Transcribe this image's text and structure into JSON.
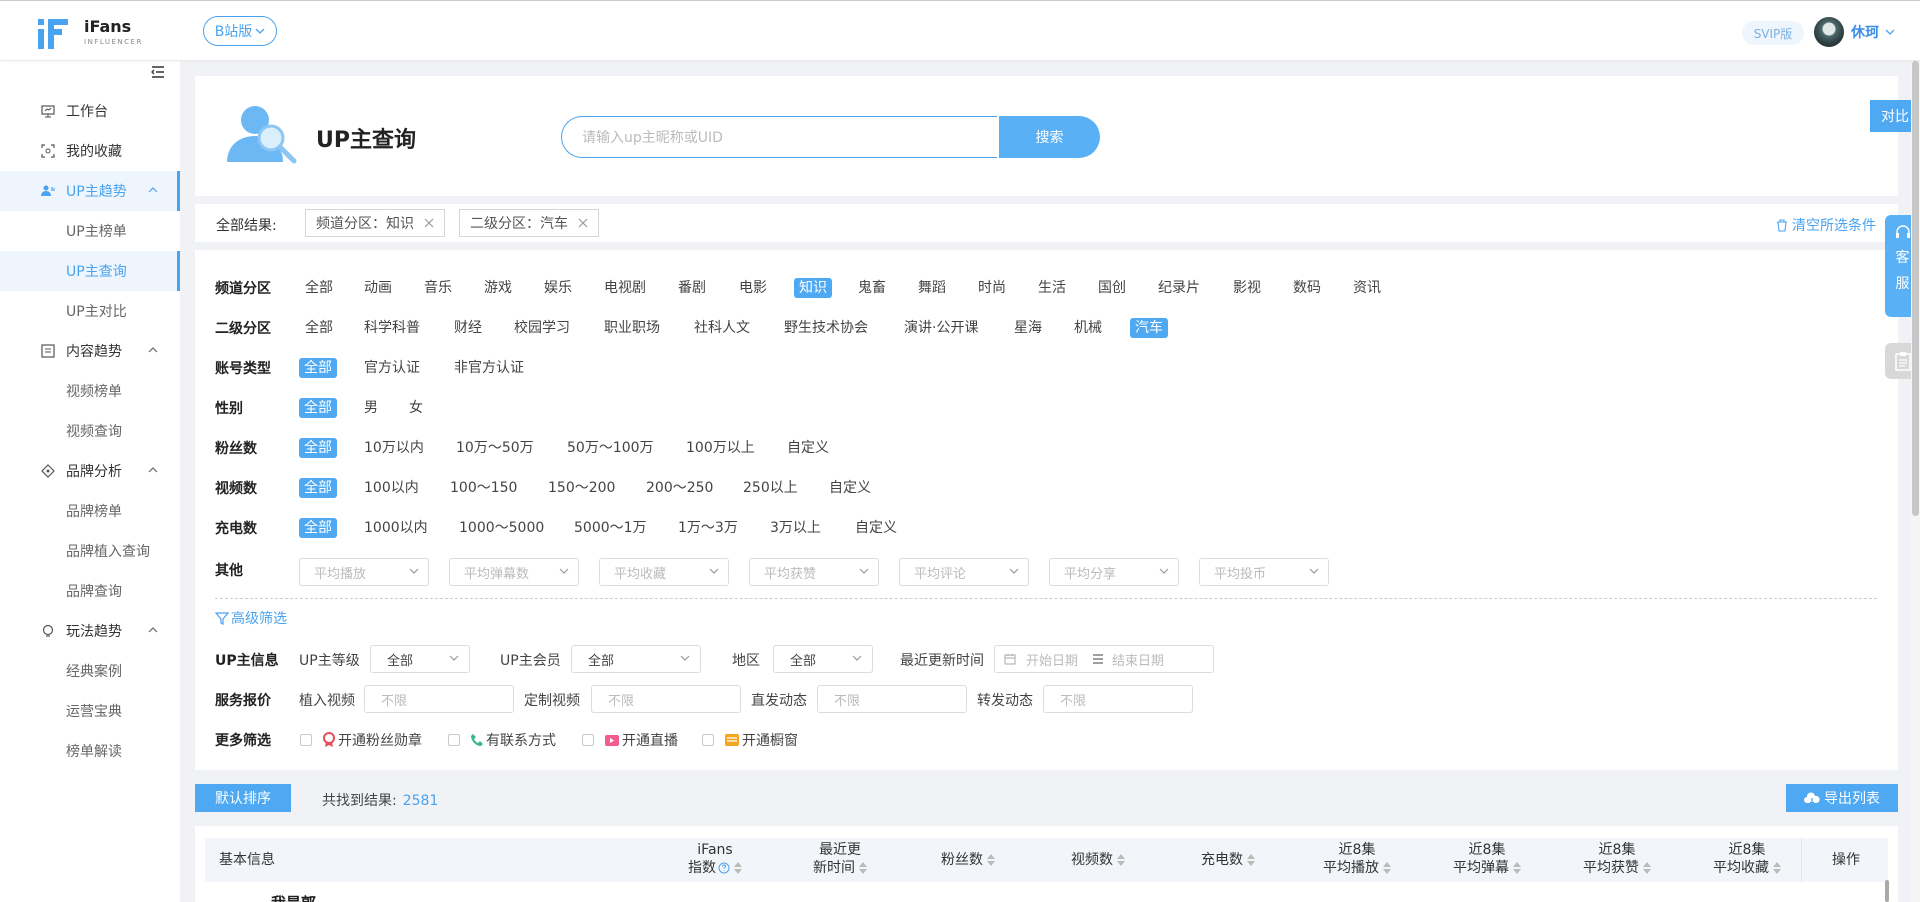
{
  "header": {
    "logo_text": "iFans",
    "logo_sub": "INFLUENCER",
    "version_label": "B站版",
    "svip_label": "SVIP版",
    "username": "休珂"
  },
  "sidebar": {
    "items": [
      {
        "label": "工作台",
        "icon": "monitor-icon"
      },
      {
        "label": "我的收藏",
        "icon": "collection-icon"
      },
      {
        "label": "UP主趋势",
        "icon": "users-icon"
      },
      {
        "label": "UP主榜单"
      },
      {
        "label": "UP主查询"
      },
      {
        "label": "UP主对比"
      },
      {
        "label": "内容趋势",
        "icon": "content-icon"
      },
      {
        "label": "视频榜单"
      },
      {
        "label": "视频查询"
      },
      {
        "label": "品牌分析",
        "icon": "diamond-icon"
      },
      {
        "label": "品牌榜单"
      },
      {
        "label": "品牌植入查询"
      },
      {
        "label": "品牌查询"
      },
      {
        "label": "玩法趋势",
        "icon": "bulb-icon"
      },
      {
        "label": "经典案例"
      },
      {
        "label": "运营宝典"
      },
      {
        "label": "榜单解读"
      }
    ]
  },
  "search": {
    "title": "UP主查询",
    "placeholder": "请输入up主昵称或UID",
    "button": "搜索"
  },
  "results": {
    "label": "全部结果:",
    "chips": [
      "频道分区：知识",
      "二级分区：汽车"
    ],
    "clear": "清空所选条件"
  },
  "filters": {
    "channel": {
      "label": "频道分区",
      "options": [
        "全部",
        "动画",
        "音乐",
        "游戏",
        "娱乐",
        "电视剧",
        "番剧",
        "电影",
        "知识",
        "鬼畜",
        "舞蹈",
        "时尚",
        "生活",
        "国创",
        "纪录片",
        "影视",
        "数码",
        "资讯"
      ]
    },
    "sub": {
      "label": "二级分区",
      "options": [
        "全部",
        "科学科普",
        "财经",
        "校园学习",
        "职业职场",
        "社科人文",
        "野生技术协会",
        "演讲·公开课",
        "星海",
        "机械",
        "汽车"
      ]
    },
    "account": {
      "label": "账号类型",
      "options": [
        "全部",
        "官方认证",
        "非官方认证"
      ]
    },
    "gender": {
      "label": "性别",
      "options": [
        "全部",
        "男",
        "女"
      ]
    },
    "fans": {
      "label": "粉丝数",
      "options": [
        "全部",
        "10万以内",
        "10万～50万",
        "50万～100万",
        "100万以上",
        "自定义"
      ]
    },
    "videos": {
      "label": "视频数",
      "options": [
        "全部",
        "100以内",
        "100～150",
        "150～200",
        "200～250",
        "250以上",
        "自定义"
      ]
    },
    "charge": {
      "label": "充电数",
      "options": [
        "全部",
        "1000以内",
        "1000～5000",
        "5000～1万",
        "1万～3万",
        "3万以上",
        "自定义"
      ]
    },
    "other": {
      "label": "其他",
      "dropdowns": [
        "平均播放",
        "平均弹幕数",
        "平均收藏",
        "平均获赞",
        "平均评论",
        "平均分享",
        "平均投币"
      ]
    },
    "advanced": "高级筛选",
    "upinfo": {
      "label": "UP主信息",
      "level_label": "UP主等级",
      "level_value": "全部",
      "member_label": "UP主会员",
      "member_value": "全部",
      "region_label": "地区",
      "region_value": "全部",
      "update_label": "最近更新时间",
      "start_ph": "开始日期",
      "end_ph": "结束日期"
    },
    "price": {
      "label": "服务报价",
      "fields": [
        {
          "label": "植入视频",
          "ph": "不限"
        },
        {
          "label": "定制视频",
          "ph": "不限"
        },
        {
          "label": "直发动态",
          "ph": "不限"
        },
        {
          "label": "转发动态",
          "ph": "不限"
        }
      ]
    },
    "more": {
      "label": "更多筛选",
      "items": [
        "开通粉丝勋章",
        "有联系方式",
        "开通直播",
        "开通橱窗"
      ]
    }
  },
  "toolbar": {
    "sort": "默认排序",
    "found_label": "共找到结果:",
    "found_count": "2581",
    "export": "导出列表"
  },
  "table": {
    "headers": [
      {
        "l1": "基本信息",
        "l2": ""
      },
      {
        "l1": "iFans",
        "l2": "指数"
      },
      {
        "l1": "最近更",
        "l2": "新时间"
      },
      {
        "l1": "粉丝数",
        "l2": ""
      },
      {
        "l1": "视频数",
        "l2": ""
      },
      {
        "l1": "充电数",
        "l2": ""
      },
      {
        "l1": "近8集",
        "l2": "平均播放"
      },
      {
        "l1": "近8集",
        "l2": "平均弹幕"
      },
      {
        "l1": "近8集",
        "l2": "平均获赞"
      },
      {
        "l1": "近8集",
        "l2": "平均收藏"
      },
      {
        "l1": "操作",
        "l2": ""
      }
    ],
    "first_row_name": "我是郭"
  },
  "float": {
    "compare": "对比",
    "service": [
      "客",
      "服"
    ]
  },
  "colors": {
    "accent": "#4aa3f0",
    "selected_bg": "#4fa9f2"
  }
}
